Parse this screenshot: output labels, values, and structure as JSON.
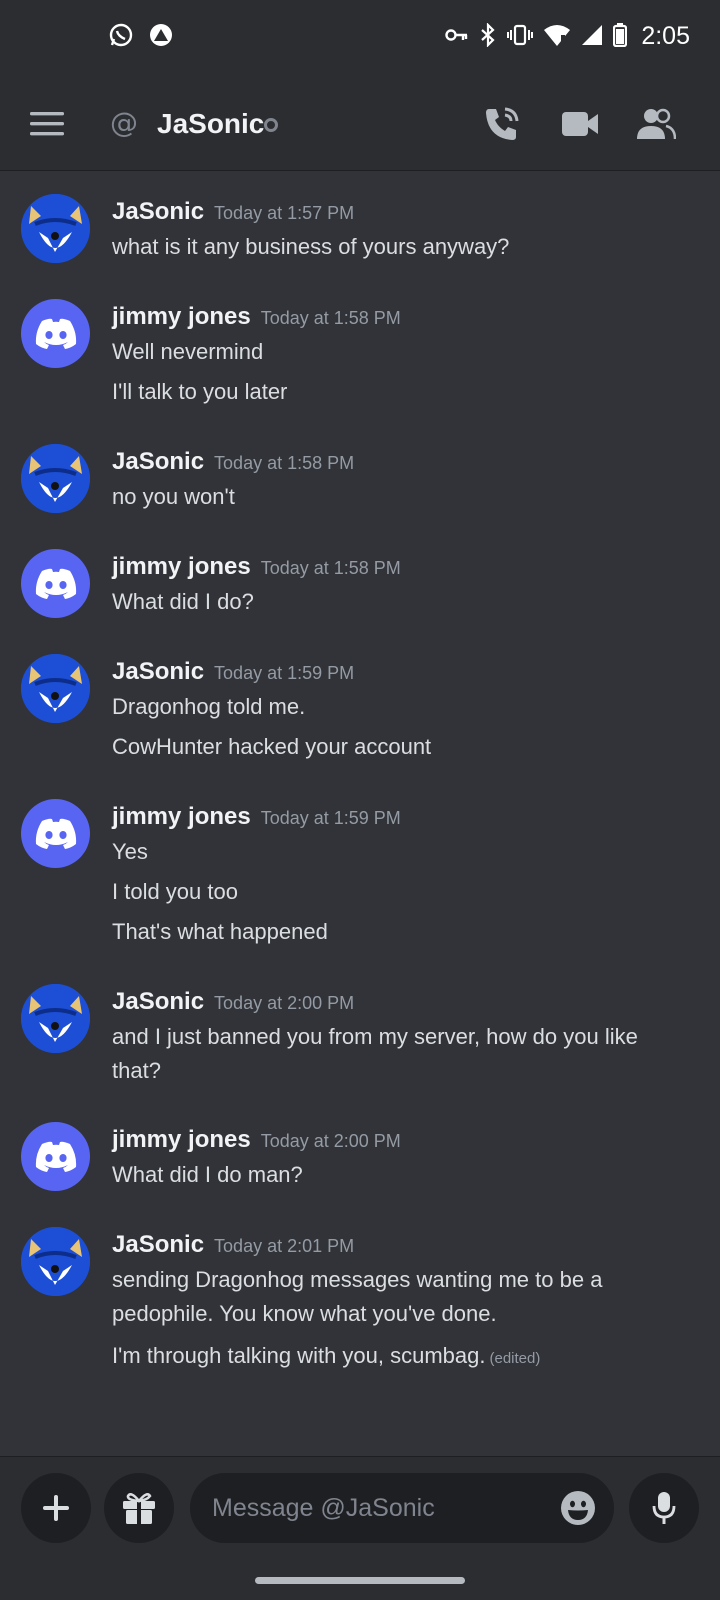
{
  "status_bar": {
    "time": "2:05",
    "icons": [
      "whatsapp-icon",
      "app-notification-icon",
      "vpn-key-icon",
      "bluetooth-icon",
      "vibrate-icon",
      "wifi-icon",
      "signal-icon",
      "battery-icon"
    ]
  },
  "header": {
    "at_symbol": "@",
    "title": "JaSonic",
    "buttons": [
      "menu-icon",
      "voice-call-icon",
      "video-call-icon",
      "members-icon"
    ]
  },
  "messages": [
    {
      "author": "JaSonic",
      "avatar": "sonic",
      "timestamp": "Today at 1:57 PM",
      "lines": [
        "what is it any business of yours anyway?"
      ]
    },
    {
      "author": "jimmy jones",
      "avatar": "discord",
      "timestamp": "Today at 1:58 PM",
      "lines": [
        "Well nevermind",
        "I'll talk to you later"
      ]
    },
    {
      "author": "JaSonic",
      "avatar": "sonic",
      "timestamp": "Today at 1:58 PM",
      "lines": [
        "no you won't"
      ]
    },
    {
      "author": "jimmy jones",
      "avatar": "discord",
      "timestamp": "Today at 1:58 PM",
      "lines": [
        "What did I do?"
      ]
    },
    {
      "author": "JaSonic",
      "avatar": "sonic",
      "timestamp": "Today at 1:59 PM",
      "lines": [
        "Dragonhog told me.",
        "CowHunter hacked your account"
      ]
    },
    {
      "author": "jimmy jones",
      "avatar": "discord",
      "timestamp": "Today at 1:59 PM",
      "lines": [
        "Yes",
        "I told you too",
        "That's what happened"
      ]
    },
    {
      "author": "JaSonic",
      "avatar": "sonic",
      "timestamp": "Today at 2:00 PM",
      "lines": [
        "and I just banned you from my server, how do you like that?"
      ]
    },
    {
      "author": "jimmy jones",
      "avatar": "discord",
      "timestamp": "Today at 2:00 PM",
      "lines": [
        "What did I do man?"
      ]
    },
    {
      "author": "JaSonic",
      "avatar": "sonic",
      "timestamp": "Today at 2:01 PM",
      "lines": [
        "sending Dragonhog messages wanting me to be a pedophile. You know what you've done.",
        "I'm through talking with you, scumbag."
      ],
      "edited_label": "(edited)"
    }
  ],
  "composer": {
    "placeholder": "Message @JaSonic",
    "value": ""
  },
  "colors": {
    "background": "#313338",
    "header_bg": "#2b2d31",
    "blurple": "#5865f2",
    "muted": "#949ba4"
  }
}
